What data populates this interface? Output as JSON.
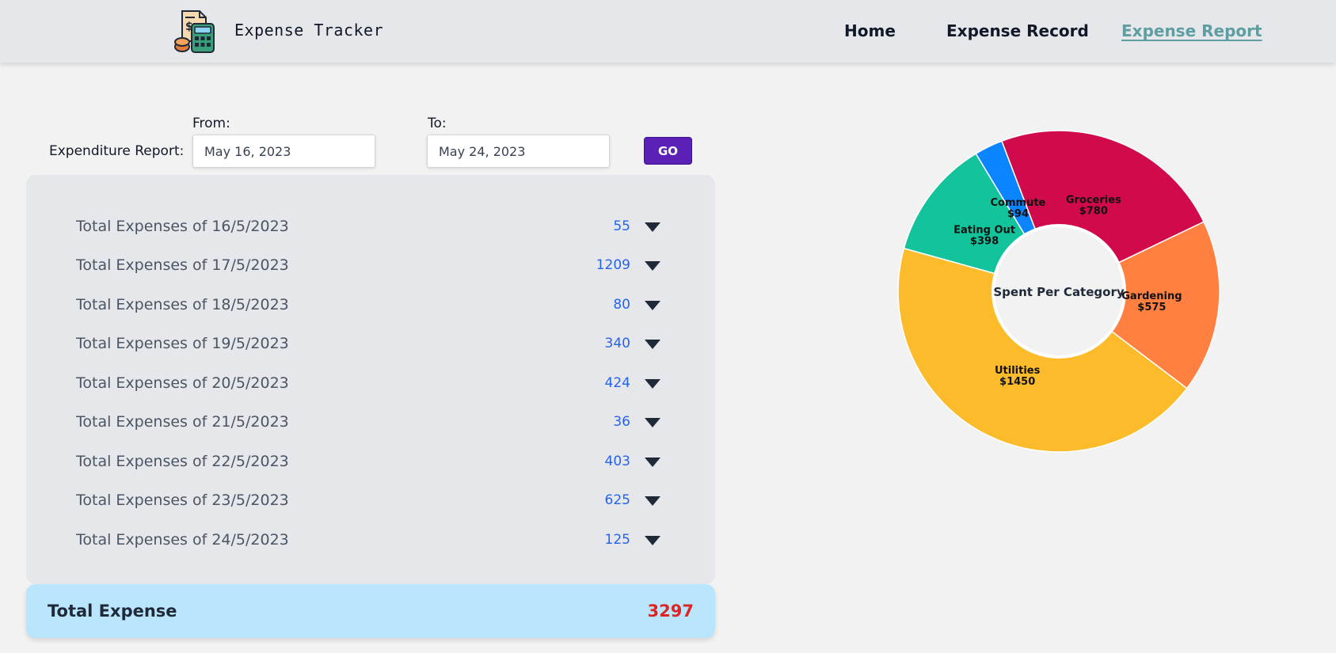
{
  "header": {
    "brand": "Expense Tracker",
    "logo_icon": "calculator-receipt-icon",
    "nav": [
      {
        "label": "Home",
        "active": false
      },
      {
        "label": "Expense Record",
        "active": false
      },
      {
        "label": "Expense Report",
        "active": true
      }
    ]
  },
  "filter": {
    "report_label": "Expenditure Report:",
    "from_label": "From:",
    "from_value": "May 16, 2023",
    "to_label": "To:",
    "to_value": "May 24, 2023",
    "go_label": "GO"
  },
  "daily_totals": [
    {
      "label": "Total Expenses of 16/5/2023",
      "value": "55"
    },
    {
      "label": "Total Expenses of 17/5/2023",
      "value": "1209"
    },
    {
      "label": "Total Expenses of 18/5/2023",
      "value": "80"
    },
    {
      "label": "Total Expenses of 19/5/2023",
      "value": "340"
    },
    {
      "label": "Total Expenses of 20/5/2023",
      "value": "424"
    },
    {
      "label": "Total Expenses of 21/5/2023",
      "value": "36"
    },
    {
      "label": "Total Expenses of 22/5/2023",
      "value": "403"
    },
    {
      "label": "Total Expenses of 23/5/2023",
      "value": "625"
    },
    {
      "label": "Total Expenses of 24/5/2023",
      "value": "125"
    }
  ],
  "total": {
    "label": "Total Expense",
    "value": "3297"
  },
  "chart_data": {
    "type": "pie",
    "center_label": "Spent Per Category",
    "slices": [
      {
        "name": "Utilities",
        "value": 1450,
        "display": "$1450",
        "color": "#fbbb2a"
      },
      {
        "name": "Eating Out",
        "value": 398,
        "display": "$398",
        "color": "#13c39c"
      },
      {
        "name": "Commute",
        "value": 94,
        "display": "$94",
        "color": "#0a84ff"
      },
      {
        "name": "Groceries",
        "value": 780,
        "display": "$780",
        "color": "#d10b4b"
      },
      {
        "name": "Gardening",
        "value": 575,
        "display": "$575",
        "color": "#ff8040"
      }
    ]
  },
  "colors": {
    "header_bg": "#e5e7eb",
    "page_bg": "#f2f2f2",
    "accent_purple": "#5b21b6",
    "active_nav": "#5f9ea0",
    "value_blue": "#2563eb",
    "total_red": "#dc2626",
    "total_bg": "#bae6fd"
  }
}
